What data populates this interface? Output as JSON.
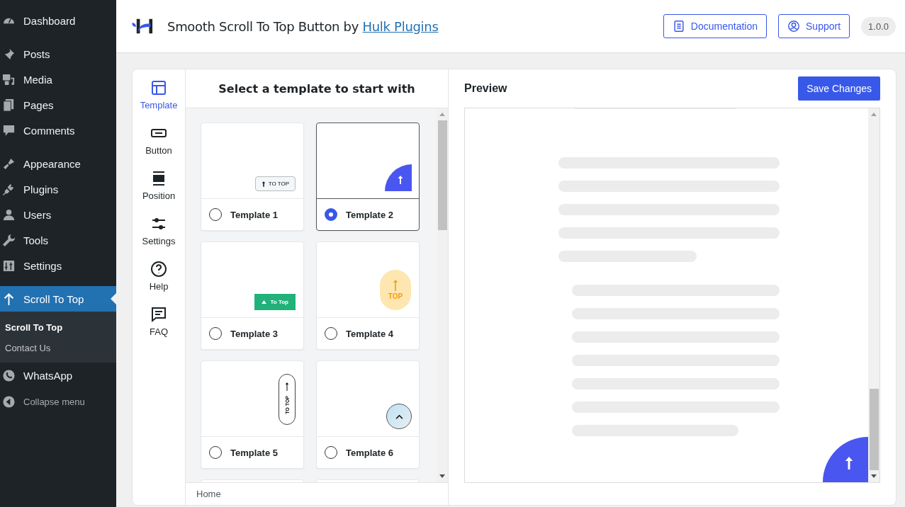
{
  "sidebar": {
    "groups": [
      [
        {
          "label": "Dashboard",
          "selected": false
        }
      ],
      [
        {
          "label": "Posts",
          "selected": false
        },
        {
          "label": "Media",
          "selected": false
        },
        {
          "label": "Pages",
          "selected": false
        },
        {
          "label": "Comments",
          "selected": false
        }
      ],
      [
        {
          "label": "Appearance",
          "selected": false
        },
        {
          "label": "Plugins",
          "selected": false
        },
        {
          "label": "Users",
          "selected": false
        },
        {
          "label": "Tools",
          "selected": false
        },
        {
          "label": "Settings",
          "selected": false
        }
      ],
      [
        {
          "label": "Scroll To Top",
          "selected": true,
          "children": [
            {
              "label": "Scroll To Top",
              "selected": true
            },
            {
              "label": "Contact Us",
              "selected": false
            }
          ]
        },
        {
          "label": "WhatsApp",
          "selected": false
        }
      ]
    ],
    "collapse": "Collapse menu"
  },
  "header": {
    "title": "Smooth Scroll To Top Button by",
    "link": "Hulk Plugins",
    "buttons": [
      "Documentation",
      "Support"
    ],
    "version": "1.0.0"
  },
  "nav": [
    {
      "label": "Template",
      "selected": true
    },
    {
      "label": "Button",
      "selected": false
    },
    {
      "label": "Position",
      "selected": false
    },
    {
      "label": "Settings",
      "selected": false
    },
    {
      "label": "Help",
      "selected": false
    },
    {
      "label": "FAQ",
      "selected": false
    }
  ],
  "templates": {
    "heading": "Select a template to start with",
    "items": [
      {
        "label": "Template 1",
        "selected": false,
        "kind": "pill",
        "text": "TO TOP"
      },
      {
        "label": "Template 2",
        "selected": true,
        "kind": "quarter"
      },
      {
        "label": "Template 3",
        "selected": false,
        "kind": "bar",
        "text": "To Top"
      },
      {
        "label": "Template 4",
        "selected": false,
        "kind": "capsule",
        "text": "TOP"
      },
      {
        "label": "Template 5",
        "selected": false,
        "kind": "vertical",
        "text": "TO TOP"
      },
      {
        "label": "Template 6",
        "selected": false,
        "kind": "circle"
      }
    ],
    "breadcrumb": "Home"
  },
  "preview": {
    "title": "Preview",
    "save": "Save Changes"
  }
}
